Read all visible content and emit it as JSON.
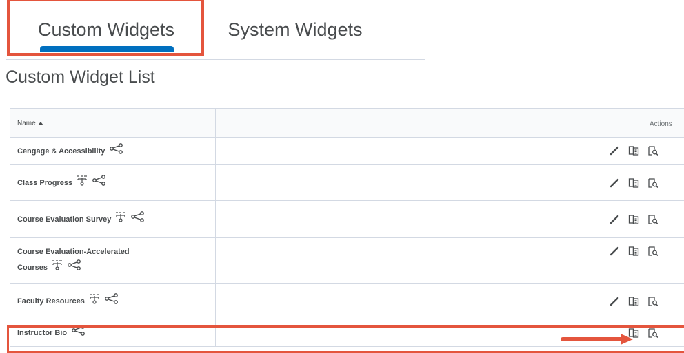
{
  "tabs": [
    {
      "label": "Custom Widgets",
      "active": true
    },
    {
      "label": "System Widgets",
      "active": false
    }
  ],
  "list_title": "Custom Widget List",
  "table": {
    "headers": {
      "name": "Name",
      "actions": "Actions"
    },
    "rows": [
      {
        "name_line1": "Cengage & Accessibility",
        "name_line2": "",
        "icons": [
          "share-icon"
        ],
        "actions": [
          "edit-icon",
          "copy-icon",
          "preview-icon"
        ]
      },
      {
        "name_line1": "Class Progress",
        "name_line2": "",
        "icons": [
          "org-hierarchy-icon",
          "share-icon"
        ],
        "actions": [
          "edit-icon",
          "copy-icon",
          "preview-icon"
        ]
      },
      {
        "name_line1": "Course Evaluation Survey",
        "name_line2": "",
        "icons": [
          "org-hierarchy-icon",
          "share-icon"
        ],
        "actions": [
          "edit-icon",
          "copy-icon",
          "preview-icon"
        ]
      },
      {
        "name_line1": "Course Evaluation-Accelerated",
        "name_line2": "Courses",
        "icons": [
          "org-hierarchy-icon",
          "share-icon"
        ],
        "actions": [
          "edit-icon",
          "copy-icon",
          "preview-icon"
        ]
      },
      {
        "name_line1": "Faculty Resources",
        "name_line2": "",
        "icons": [
          "org-hierarchy-icon",
          "share-icon"
        ],
        "actions": [
          "edit-icon",
          "copy-icon",
          "preview-icon"
        ]
      },
      {
        "name_line1": "Instructor Bio",
        "name_line2": "",
        "icons": [
          "share-icon"
        ],
        "actions": [
          "copy-icon",
          "preview-icon"
        ]
      }
    ]
  },
  "colors": {
    "accent": "#006fbf",
    "highlight": "#e4553d",
    "border": "#d3d9e3"
  }
}
